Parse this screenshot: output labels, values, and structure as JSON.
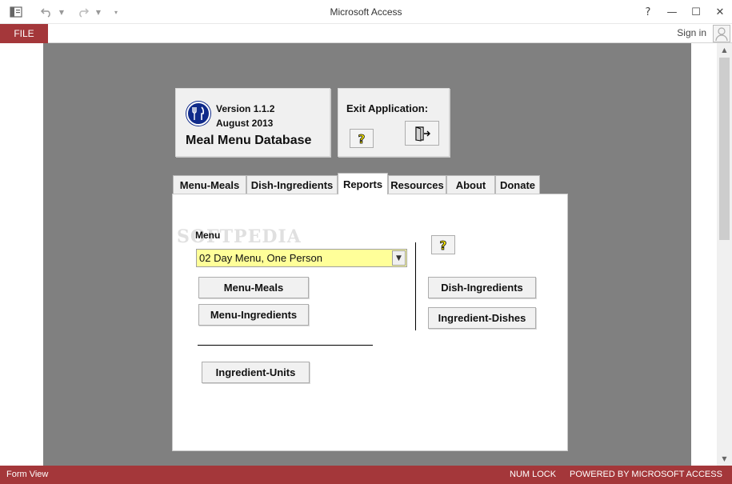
{
  "window": {
    "title": "Microsoft Access",
    "controls": {
      "help": "?",
      "minimize": "—",
      "maximize": "☐",
      "close": "✕"
    }
  },
  "ribbon": {
    "file_label": "FILE",
    "signin_label": "Sign in"
  },
  "header": {
    "version": "Version 1.1.2",
    "date": "August 2013",
    "db_title": "Meal Menu Database",
    "exit_label": "Exit Application:"
  },
  "tabs": [
    {
      "label": "Menu-Meals"
    },
    {
      "label": "Dish-Ingredients"
    },
    {
      "label": "Reports",
      "active": true
    },
    {
      "label": "Resources"
    },
    {
      "label": "About"
    },
    {
      "label": "Donate"
    }
  ],
  "reports": {
    "menu_label": "Menu",
    "menu_value": "02 Day Menu, One Person",
    "buttons": {
      "menu_meals": "Menu-Meals",
      "menu_ingredients": "Menu-Ingredients",
      "ingredient_units": "Ingredient-Units",
      "dish_ingredients": "Dish-Ingredients",
      "ingredient_dishes": "Ingredient-Dishes"
    },
    "help_glyph": "?"
  },
  "watermark": "SOFTPEDIA",
  "status": {
    "view": "Form View",
    "num_lock": "NUM LOCK",
    "powered_by": "POWERED BY MICROSOFT ACCESS"
  },
  "colors": {
    "accent": "#a4373a",
    "form_bg": "#808080",
    "combo_bg": "#ffff99"
  }
}
